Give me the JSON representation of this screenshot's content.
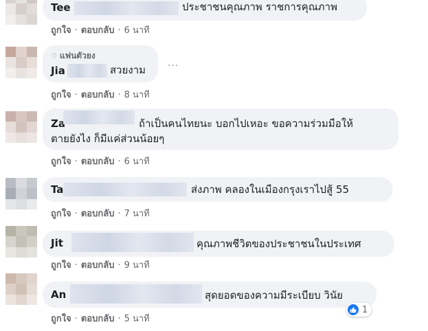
{
  "labels": {
    "like": "ถูกใจ",
    "reply": "ตอบกลับ",
    "separator": "·"
  },
  "comments": [
    {
      "author": "Tee",
      "text": "ประชาชนคุณภาพ ราชการคุณภาพ",
      "time": "6 นาที"
    },
    {
      "badge": "แฟนตัวยง",
      "author": "Jia",
      "text": "สวยงาม",
      "time": "8 นาที",
      "more": "···"
    },
    {
      "author": "Za",
      "text_line1": "ถ้าเป็นคนไทยนะ บอกไปเหอะ ขอความร่วมมือให้",
      "text_line2": "ตายยังไง ก็มีแค่ส่วนน้อยๆ",
      "time": "6 นาที"
    },
    {
      "author": "Ta",
      "text": "ส่งภาพ คลองในเมืองกรุงเราไปสู้ 55",
      "time": "7 นาที"
    },
    {
      "author": "Jit",
      "text": "คุณภาพชีวิตของประชาชนในประเทศ",
      "time": "9 นาที"
    },
    {
      "author": "An",
      "text": "สุดยอดของความมีระเบียบ วินัย",
      "time": "5 นาที",
      "reaction_count": "1"
    }
  ],
  "colors": {
    "bubble": "#f0f2f5",
    "name": "#1c1e21",
    "meta": "#65676b",
    "like_blue": "#1877f2"
  }
}
